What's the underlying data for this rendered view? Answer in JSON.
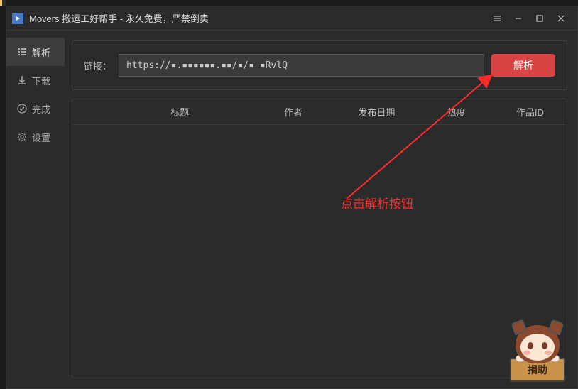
{
  "title": "Movers 搬运工好帮手 - 永久免费，严禁倒卖",
  "sidebar": {
    "items": [
      {
        "label": "解析"
      },
      {
        "label": "下载"
      },
      {
        "label": "完成"
      },
      {
        "label": "设置"
      }
    ]
  },
  "input": {
    "label": "链接：",
    "value": "https://▪.▪▪▪▪▪▪.▪▪/▪/▪ ▪RvlQ",
    "button": "解析"
  },
  "table": {
    "headers": [
      "",
      "标题",
      "作者",
      "发布日期",
      "热度",
      "作品ID"
    ]
  },
  "annotation": {
    "text": "点击解析按钮"
  },
  "mascot": {
    "label": "捐助"
  }
}
